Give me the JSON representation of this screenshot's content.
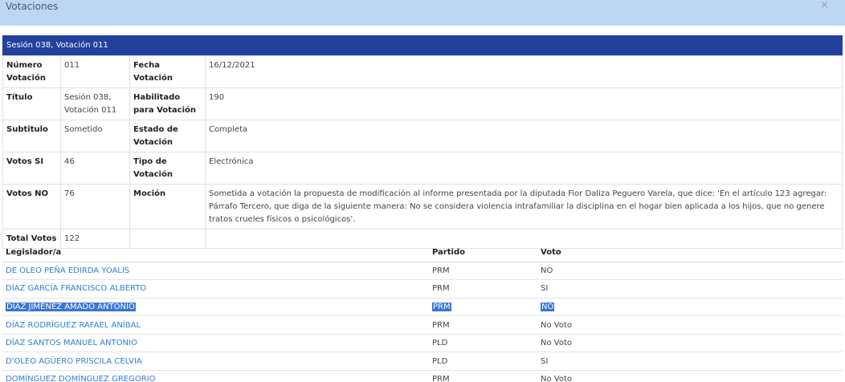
{
  "modal": {
    "title": "Votaciones",
    "close_symbol": "×"
  },
  "section_title": "Sesión 038, Votación 011",
  "details": {
    "numero_label": "Número Votación",
    "numero_value": "011",
    "fecha_label": "Fecha Votación",
    "fecha_value": "16/12/2021",
    "titulo_label": "Título",
    "titulo_value": "Sesión 038, Votación 011",
    "habilitado_label": "Habilitado para Votación",
    "habilitado_value": "190",
    "subtitulo_label": "Subtitulo",
    "subtitulo_value": "Sometido",
    "estado_label": "Estado de Votación",
    "estado_value": "Completa",
    "votos_si_label": "Votos SI",
    "votos_si_value": "46",
    "tipo_label": "Tipo de Votación",
    "tipo_value": "Electrónica",
    "votos_no_label": "Votos NO",
    "votos_no_value": "76",
    "mocion_label": "Moción",
    "mocion_value": "Sometida a votación la propuesta de modificación al informe presentada por la diputada Fior Daliza Peguero Varela, que dice: 'En el artículo 123 agregar: Párrafo Tercero, que diga de la siguiente manera: No se considera violencia intrafamiliar la disciplina en el hogar bien aplicada a los hijos, que no genere tratos crueles físicos o psicológicos'.",
    "total_label": "Total Votos",
    "total_value": "122"
  },
  "votes": {
    "headers": {
      "legislador": "Legislador/a",
      "partido": "Partido",
      "voto": "Voto"
    },
    "rows": [
      {
        "legislador": "DE OLEO PEÑA EDIRDA YOALIS",
        "partido": "PRM",
        "voto": "NO"
      },
      {
        "legislador": "DÍAZ GARCÍA FRANCISCO ALBERTO",
        "partido": "PRM",
        "voto": "SI"
      },
      {
        "legislador": "DÍAZ JIMÉNEZ AMADO ANTONIO",
        "partido": "PRM",
        "voto": "NO"
      },
      {
        "legislador": "DÍAZ RODRÍGUEZ RAFAEL ANÍBAL",
        "partido": "PRM",
        "voto": "No Voto"
      },
      {
        "legislador": "DÍAZ SANTOS MANUEL ANTONIO",
        "partido": "PLD",
        "voto": "No Voto"
      },
      {
        "legislador": "D'OLEO AGÜERO PRISCILA CELVIA",
        "partido": "PLD",
        "voto": "SI"
      },
      {
        "legislador": "DOMÍNGUEZ DOMÍNGUEZ GREGORIO",
        "partido": "PRM",
        "voto": "No Voto"
      }
    ]
  },
  "colors": {
    "header_bg": "#bdd7f3",
    "section_bg": "#23409c",
    "link": "#2f7fd1",
    "selection": "#3a76d6"
  }
}
